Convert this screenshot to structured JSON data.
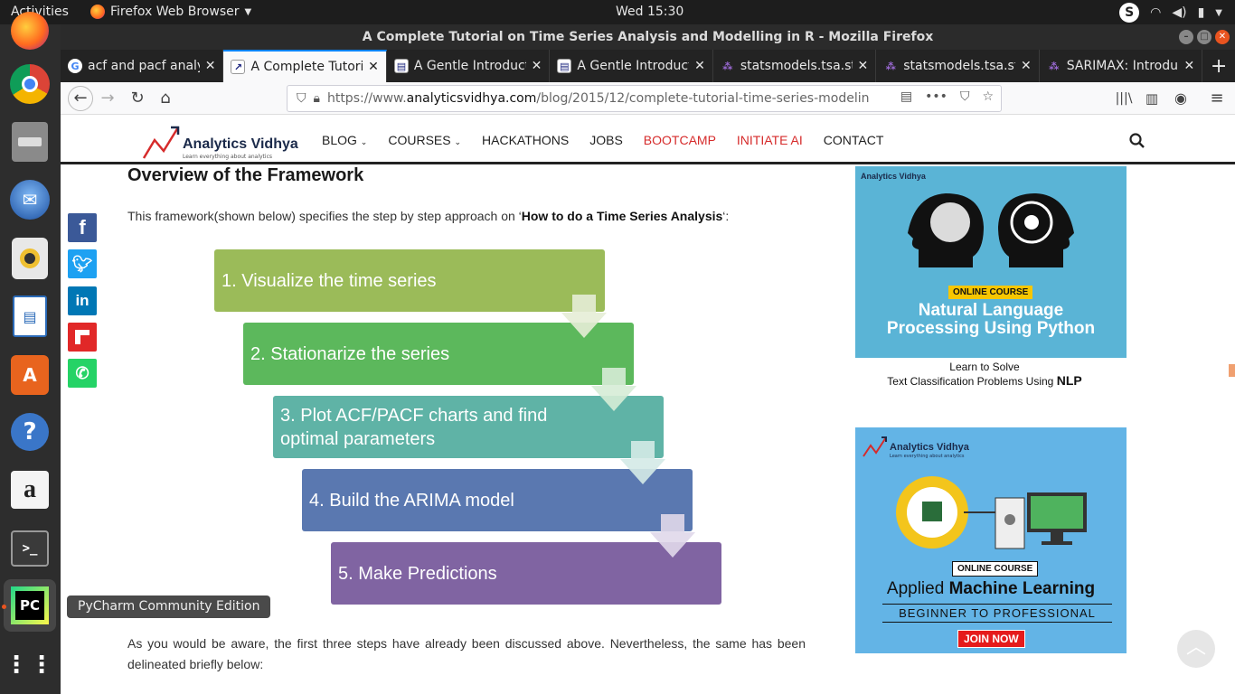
{
  "topbar": {
    "activities": "Activities",
    "app_name": "Firefox Web Browser",
    "clock": "Wed 15:30"
  },
  "window": {
    "title": "A Complete Tutorial on Time Series Analysis and Modelling in R - Mozilla Firefox"
  },
  "tabs": [
    {
      "label": "acf and pacf analy",
      "icon": "google-icon"
    },
    {
      "label": "A Complete Tutori",
      "icon": "analytics-vidhya-icon",
      "active": true
    },
    {
      "label": "A Gentle Introduct",
      "icon": "page-icon"
    },
    {
      "label": "A Gentle Introduct",
      "icon": "page-icon"
    },
    {
      "label": "statsmodels.tsa.st",
      "icon": "statsmodels-icon"
    },
    {
      "label": "statsmodels.tsa.st",
      "icon": "statsmodels-icon"
    },
    {
      "label": "SARIMAX: Introdu",
      "icon": "statsmodels-icon"
    }
  ],
  "urlbar": {
    "prefix": "https://www.",
    "host": "analyticsvidhya.com",
    "path": "/blog/2015/12/complete-tutorial-time-series-modelin"
  },
  "site": {
    "logo_name": "Analytics Vidhya",
    "logo_tagline": "Learn everything about analytics",
    "menu": [
      "BLOG",
      "COURSES",
      "HACKATHONS",
      "JOBS",
      "BOOTCAMP",
      "INITIATE AI",
      "CONTACT"
    ]
  },
  "article": {
    "title": "Overview of the Framework",
    "intro_before": "This framework(shown below) specifies the step by step approach on ‘",
    "intro_bold": "How to do a Time Series Analysis",
    "intro_after": "‘:",
    "steps": [
      {
        "label": "1.  Visualize the time series",
        "color": "#9bbb59"
      },
      {
        "label": "2. Stationarize the series",
        "color": "#5cb85c"
      },
      {
        "label": "3. Plot ACF/PACF charts and find optimal parameters",
        "color": "#5fb3a6"
      },
      {
        "label": "4. Build the ARIMA model",
        "color": "#5a78b0"
      },
      {
        "label": "5. Make Predictions",
        "color": "#8064a2"
      }
    ],
    "outro": "As you would be aware, the first three steps have already been discussed above. Nevertheless, the same has been delineated briefly below:"
  },
  "tooltip": "PyCharm Community Edition",
  "ad1": {
    "brand": "Analytics Vidhya",
    "badge": "ONLINE COURSE",
    "title_line1": "Natural Language",
    "title_line2": "Processing Using Python",
    "sub_line1": "Learn to Solve",
    "sub_line2": "Text Classification Problems Using",
    "sub_bold": "NLP"
  },
  "ad2": {
    "brand": "Analytics Vidhya",
    "tagline": "Learn everything about analytics",
    "badge": "ONLINE COURSE",
    "title_plain": "Applied ",
    "title_bold": "Machine Learning",
    "subtitle": "BEGINNER TO PROFESSIONAL",
    "cta": "JOIN NOW"
  }
}
